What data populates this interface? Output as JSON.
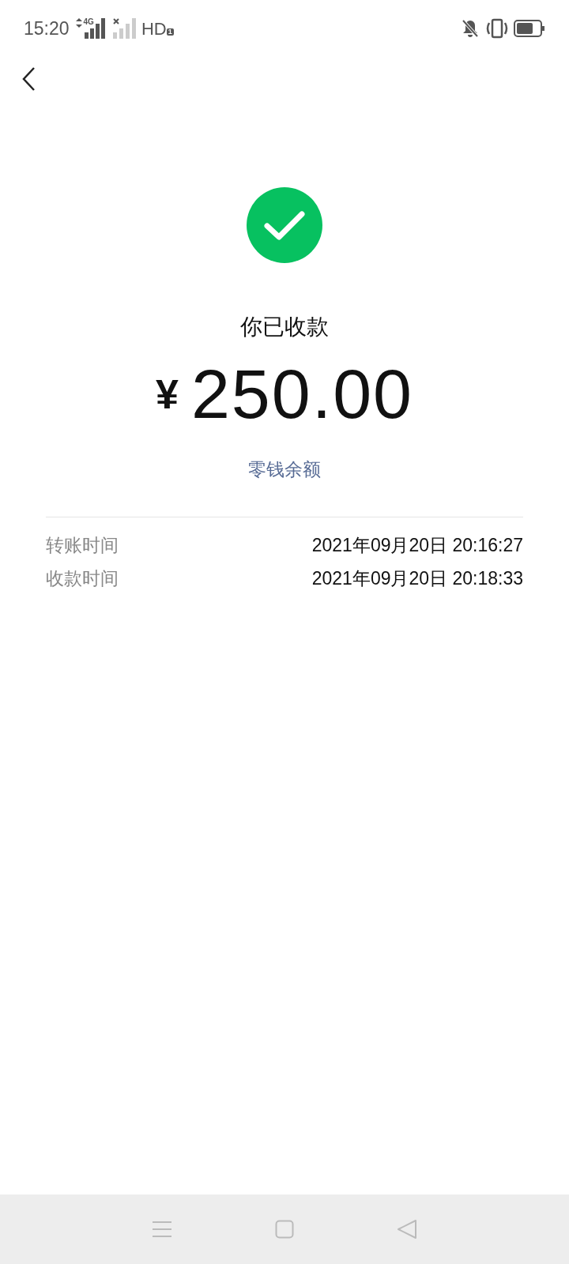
{
  "status_bar": {
    "time": "15:20",
    "network": "4G",
    "hd": "HD",
    "sim": "1"
  },
  "result": {
    "title": "你已收款",
    "currency": "¥",
    "amount": "250.00",
    "link": "零钱余额"
  },
  "details": [
    {
      "label": "转账时间",
      "value": "2021年09月20日 20:16:27"
    },
    {
      "label": "收款时间",
      "value": "2021年09月20日 20:18:33"
    }
  ]
}
